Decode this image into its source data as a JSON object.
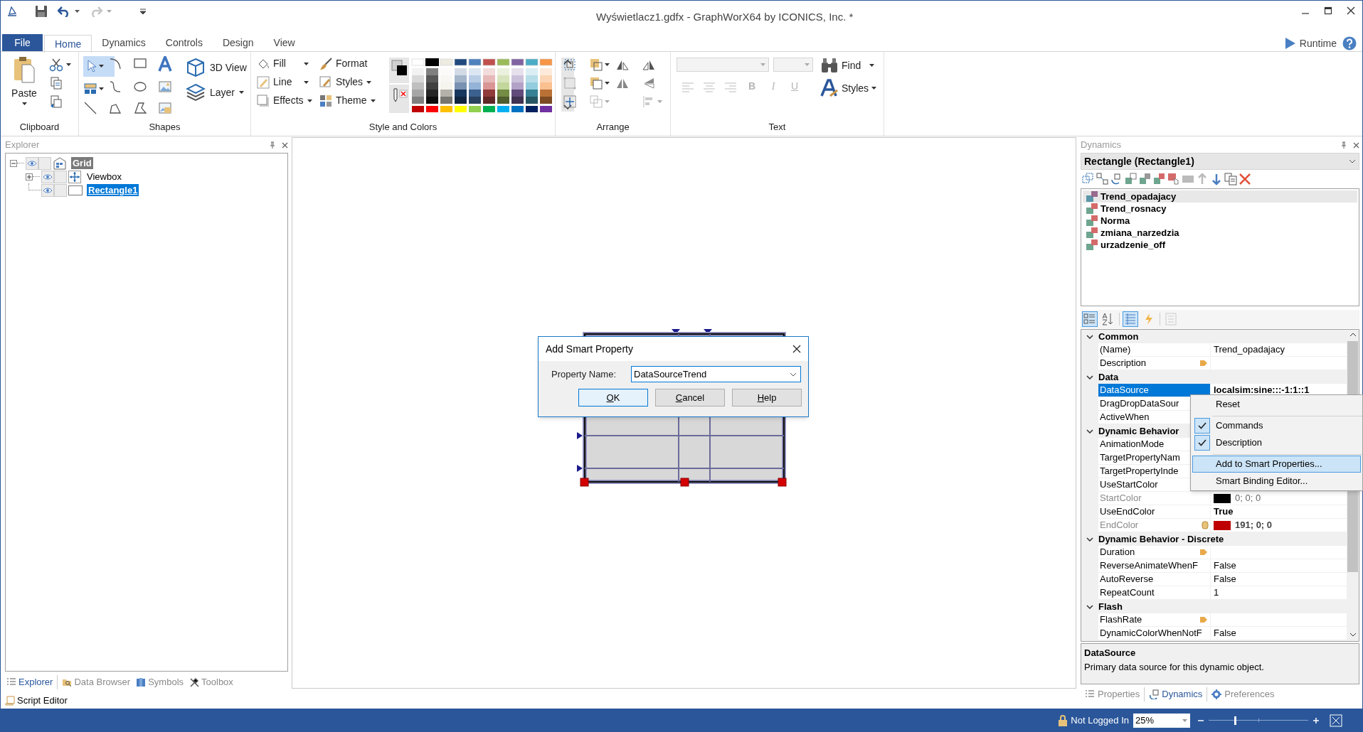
{
  "title_bar": {
    "title": "Wyświetlacz1.gdfx - GraphWorX64 by ICONICS, Inc. *"
  },
  "ribbon_tabs": [
    {
      "label": "File",
      "kind": "file",
      "selected": false
    },
    {
      "label": "Home",
      "kind": "tab",
      "selected": true
    },
    {
      "label": "Dynamics",
      "kind": "tab",
      "selected": false
    },
    {
      "label": "Controls",
      "kind": "tab",
      "selected": false
    },
    {
      "label": "Design",
      "kind": "tab",
      "selected": false
    },
    {
      "label": "View",
      "kind": "tab",
      "selected": false
    }
  ],
  "runtime_button": "Runtime",
  "ribbon": {
    "clipboard": {
      "paste": "Paste",
      "label": "Clipboard"
    },
    "shapes": {
      "view_3d": "3D View",
      "layer": "Layer",
      "label": "Shapes"
    },
    "style": {
      "fill": "Fill",
      "line": "Line",
      "effects": "Effects",
      "format": "Format",
      "styles": "Styles",
      "theme": "Theme",
      "label": "Style and Colors"
    },
    "arrange": {
      "label": "Arrange"
    },
    "text": {
      "find": "Find",
      "bold": "B",
      "italic": "I",
      "underline": "U",
      "styles": "Styles",
      "label": "Text"
    }
  },
  "explorer": {
    "title": "Explorer",
    "tree": [
      {
        "label": "Grid",
        "kind": "grid",
        "expanded": true,
        "highlighted": true,
        "selected": false,
        "children": [
          {
            "label": "Viewbox",
            "kind": "viewbox",
            "expanded": false,
            "highlighted": false,
            "selected": false
          },
          {
            "label": "Rectangle1",
            "kind": "rectangle",
            "selected": true
          }
        ]
      }
    ]
  },
  "explorer_tabs": [
    {
      "label": "Explorer",
      "selected": true
    },
    {
      "label": "Data Browser",
      "selected": false
    },
    {
      "label": "Symbols",
      "selected": false
    },
    {
      "label": "Toolbox",
      "selected": false
    }
  ],
  "script_editor": "Script Editor",
  "dialog": {
    "title": "Add Smart Property",
    "field_label": "Property Name:",
    "value": "DataSourceTrend",
    "buttons": [
      {
        "label": "OK",
        "default": true
      },
      {
        "label": "Cancel",
        "default": false
      },
      {
        "label": "Help",
        "default": false
      }
    ]
  },
  "dynamics": {
    "title": "Dynamics",
    "object": "Rectangle (Rectangle1)",
    "items": [
      {
        "label": "Trend_opadajacy",
        "selected": true
      },
      {
        "label": "Trend_rosnacy",
        "selected": false
      },
      {
        "label": "Norma",
        "selected": false
      },
      {
        "label": "zmiana_narzedzia",
        "selected": false
      },
      {
        "label": "urzadzenie_off",
        "selected": false
      }
    ]
  },
  "property_view_buttons": [
    {
      "kind": "categorized",
      "selected": true
    },
    {
      "kind": "alphabetical",
      "selected": false
    },
    {
      "kind": "properties",
      "selected": true
    },
    {
      "kind": "events",
      "selected": false
    },
    {
      "kind": "pages",
      "selected": false
    }
  ],
  "properties": [
    {
      "name": "Common",
      "expanded": true,
      "rows": [
        {
          "kind": "plain",
          "name": "(Name)",
          "value": "Trend_opadajacy",
          "modified": false,
          "disabled": false,
          "selected": false
        },
        {
          "kind": "tag",
          "name": "Description",
          "disabled": false,
          "selected": false
        }
      ]
    },
    {
      "name": "Data",
      "expanded": true,
      "rows": [
        {
          "kind": "plain",
          "name": "DataSource",
          "value": "localsim:sine:::-1:1::1",
          "modified": true,
          "disabled": false,
          "selected": true
        },
        {
          "kind": "plain",
          "name": "DragDropDataSour",
          "disabled": false,
          "selected": false
        },
        {
          "kind": "plain",
          "name": "ActiveWhen",
          "disabled": false,
          "selected": false
        }
      ]
    },
    {
      "name": "Dynamic Behavior",
      "expanded": true,
      "rows": [
        {
          "kind": "plain",
          "name": "AnimationMode",
          "disabled": false,
          "selected": false
        },
        {
          "kind": "plain",
          "name": "TargetPropertyNam",
          "disabled": false,
          "selected": false
        },
        {
          "kind": "plain",
          "name": "TargetPropertyInde",
          "disabled": false,
          "selected": false
        },
        {
          "kind": "plain",
          "name": "UseStartColor",
          "disabled": false,
          "selected": false
        },
        {
          "kind": "color",
          "name": "StartColor",
          "color": "#000000",
          "value": "0; 0; 0",
          "modified": false,
          "disabled": true,
          "selected": false
        },
        {
          "kind": "plain",
          "name": "UseEndColor",
          "value": "True",
          "modified": true,
          "disabled": false,
          "selected": false
        },
        {
          "kind": "database_color",
          "name": "EndColor",
          "color": "#bf0000",
          "value": "191; 0; 0",
          "modified": true,
          "disabled": true,
          "selected": false
        }
      ]
    },
    {
      "name": "Dynamic Behavior - Discrete",
      "expanded": true,
      "rows": [
        {
          "kind": "tag",
          "name": "Duration",
          "disabled": false,
          "selected": false
        },
        {
          "kind": "plain",
          "name": "ReverseAnimateWhenF",
          "value": "False",
          "modified": false,
          "disabled": false,
          "selected": false
        },
        {
          "kind": "plain",
          "name": "AutoReverse",
          "value": "False",
          "modified": false,
          "disabled": false,
          "selected": false
        },
        {
          "kind": "plain",
          "name": "RepeatCount",
          "value": "1",
          "modified": false,
          "disabled": false,
          "selected": false
        }
      ]
    },
    {
      "name": "Flash",
      "expanded": true,
      "rows": [
        {
          "kind": "tag",
          "name": "FlashRate",
          "disabled": false,
          "selected": false
        },
        {
          "kind": "plain",
          "name": "DynamicColorWhenNotF",
          "value": "False",
          "modified": false,
          "disabled": false,
          "selected": false
        }
      ]
    }
  ],
  "description": {
    "title": "DataSource",
    "text": "Primary data source for this dynamic object."
  },
  "panel_tabs": [
    {
      "label": "Properties",
      "selected": false
    },
    {
      "label": "Dynamics",
      "selected": true
    },
    {
      "label": "Preferences",
      "selected": false
    }
  ],
  "context_menu": {
    "items": [
      {
        "label": "Reset",
        "checked": false,
        "selected": false,
        "separator_before": false
      },
      {
        "label": "Commands",
        "checked": true,
        "selected": false,
        "separator_before": true
      },
      {
        "label": "Description",
        "checked": true,
        "selected": false,
        "separator_before": false
      },
      {
        "label": "Add to Smart Properties...",
        "checked": false,
        "selected": true,
        "separator_before": true
      },
      {
        "label": "Smart Binding Editor...",
        "checked": false,
        "selected": false,
        "separator_before": false
      }
    ]
  },
  "status_bar": {
    "login": "Not Logged In",
    "zoom": "25%",
    "zoom_slider": {
      "level": 0.26
    }
  }
}
